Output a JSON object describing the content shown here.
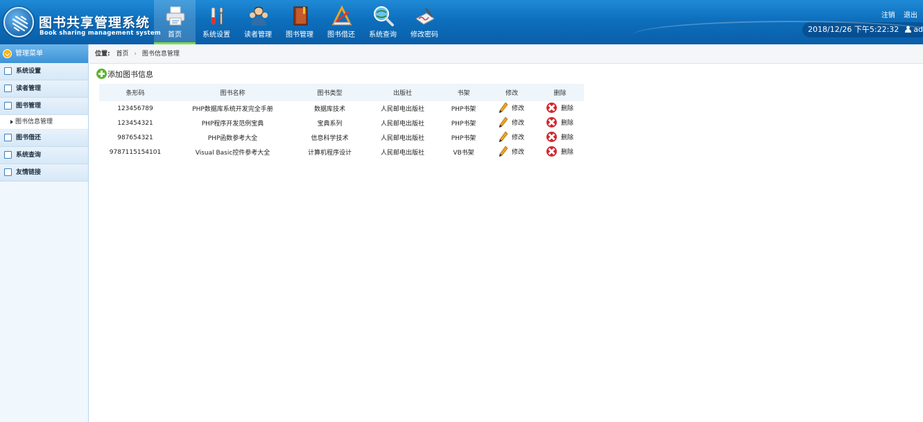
{
  "header": {
    "title": "图书共享管理系统",
    "subtitle": "Book sharing management system",
    "nav": [
      {
        "label": "首页",
        "icon": "printer-icon",
        "active": true
      },
      {
        "label": "系统设置",
        "icon": "tools-icon",
        "active": false
      },
      {
        "label": "读者管理",
        "icon": "users-icon",
        "active": false
      },
      {
        "label": "图书管理",
        "icon": "book-icon",
        "active": false
      },
      {
        "label": "图书借还",
        "icon": "drafting-icon",
        "active": false
      },
      {
        "label": "系统查询",
        "icon": "search-globe-icon",
        "active": false
      },
      {
        "label": "修改密码",
        "icon": "signature-icon",
        "active": false
      }
    ],
    "logout_label": "注销",
    "exit_label": "退出",
    "datetime": "2018/12/26 下午5:22:32",
    "username": "admin"
  },
  "sidebar": {
    "heading": "管理菜单",
    "items": [
      {
        "label": "系统设置"
      },
      {
        "label": "读者管理"
      },
      {
        "label": "图书管理"
      },
      {
        "label": "图书信息管理"
      },
      {
        "label": "图书借还"
      },
      {
        "label": "系统查询"
      },
      {
        "label": "友情链接"
      }
    ]
  },
  "breadcrumb": {
    "prefix": "位置:",
    "home": "首页",
    "current": "图书信息管理"
  },
  "main": {
    "add_label": "添加图书信息",
    "columns": [
      "条形码",
      "图书名称",
      "图书类型",
      "出版社",
      "书架",
      "修改",
      "删除"
    ],
    "edit_label": "修改",
    "delete_label": "删除",
    "rows": [
      [
        "123456789",
        "PHP数据库系统开发完全手册",
        "数据库技术",
        "人民邮电出版社",
        "PHP书架"
      ],
      [
        "123454321",
        "PHP程序开发范例宝典",
        "宝典系列",
        "人民邮电出版社",
        "PHP书架"
      ],
      [
        "987654321",
        "PHP函数参考大全",
        "信息科学技术",
        "人民邮电出版社",
        "PHP书架"
      ],
      [
        "9787115154101",
        "Visual Basic控件参考大全",
        "计算机程序设计",
        "人民邮电出版社",
        "VB书架"
      ]
    ]
  },
  "colors": {
    "header_blue": "#0d6fbd",
    "active_underline": "#7fdc3f",
    "add_green": "#5bb62c",
    "delete_red": "#d2282f"
  }
}
